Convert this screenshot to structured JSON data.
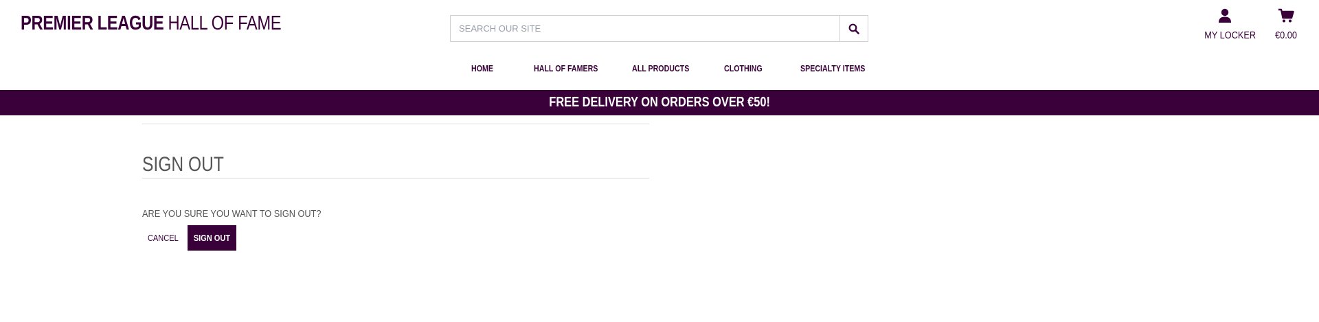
{
  "header": {
    "brand_bold": "PREMIER LEAGUE",
    "brand_light": "HALL OF FAME",
    "search": {
      "placeholder": "SEARCH OUR SITE",
      "button_icon": "search-icon"
    },
    "locker": {
      "label": "MY LOCKER",
      "icon": "user-icon"
    },
    "cart": {
      "label": "€0.00",
      "icon": "shopping-cart-icon"
    }
  },
  "nav": {
    "items": [
      {
        "label": "HOME"
      },
      {
        "label": "HALL OF FAMERS"
      },
      {
        "label": "ALL PRODUCTS"
      },
      {
        "label": "CLOTHING"
      },
      {
        "label": "SPECIALTY ITEMS"
      }
    ]
  },
  "banner": {
    "text": "FREE DELIVERY ON ORDERS OVER €50!"
  },
  "main": {
    "title": "SIGN OUT",
    "question": "ARE YOU SURE YOU WANT TO SIGN OUT?",
    "cancel_label": "CANCEL",
    "signout_label": "SIGN OUT"
  },
  "colors": {
    "brand": "#3a003a",
    "text_muted": "#555555",
    "border": "#cfcfd4"
  }
}
